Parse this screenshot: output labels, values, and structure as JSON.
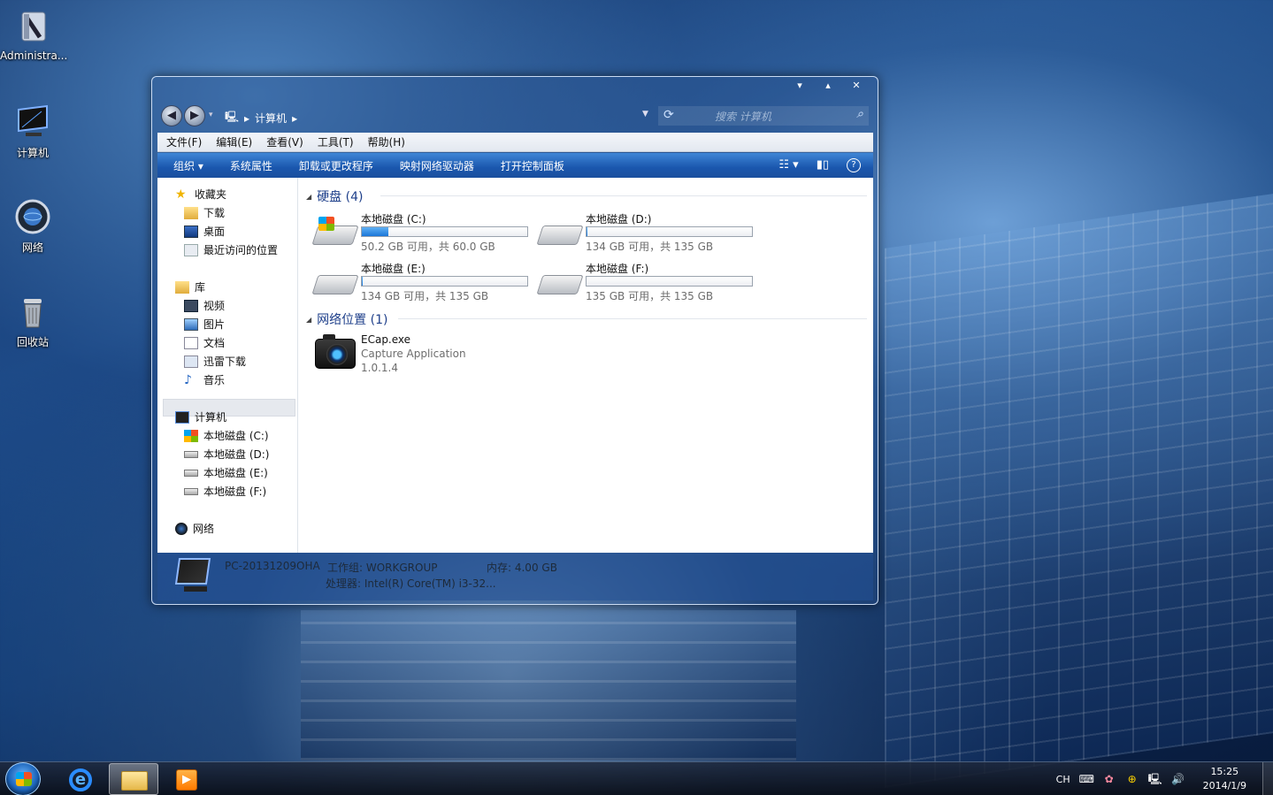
{
  "desktop": {
    "icons": [
      {
        "label": "Administra...",
        "icon": "user-folder-icon"
      },
      {
        "label": "计算机",
        "icon": "computer-icon"
      },
      {
        "label": "网络",
        "icon": "network-icon"
      },
      {
        "label": "回收站",
        "icon": "recycle-bin-icon"
      }
    ]
  },
  "window": {
    "breadcrumb": [
      "计算机"
    ],
    "search_placeholder": "搜索 计算机",
    "menu": [
      "文件(F)",
      "编辑(E)",
      "查看(V)",
      "工具(T)",
      "帮助(H)"
    ],
    "commands": [
      "组织 ▾",
      "系统属性",
      "卸载或更改程序",
      "映射网络驱动器",
      "打开控制面板"
    ],
    "nav": {
      "favorites": {
        "label": "收藏夹",
        "items": [
          "下载",
          "桌面",
          "最近访问的位置"
        ]
      },
      "libraries": {
        "label": "库",
        "items": [
          "视频",
          "图片",
          "文档",
          "迅雷下载",
          "音乐"
        ]
      },
      "computer": {
        "label": "计算机",
        "items": [
          "本地磁盘 (C:)",
          "本地磁盘 (D:)",
          "本地磁盘 (E:)",
          "本地磁盘 (F:)"
        ]
      },
      "network": {
        "label": "网络"
      }
    },
    "groups": {
      "hdd_header": "硬盘 (4)",
      "net_header": "网络位置 (1)"
    },
    "drives": [
      {
        "name": "本地磁盘 (C:)",
        "info": "50.2 GB 可用，共 60.0 GB",
        "used_fraction": 0.163,
        "system": true
      },
      {
        "name": "本地磁盘 (D:)",
        "info": "134 GB 可用，共 135 GB",
        "used_fraction": 0.007,
        "system": false
      },
      {
        "name": "本地磁盘 (E:)",
        "info": "134 GB 可用，共 135 GB",
        "used_fraction": 0.007,
        "system": false
      },
      {
        "name": "本地磁盘 (F:)",
        "info": "135 GB 可用，共 135 GB",
        "used_fraction": 0.0,
        "system": false
      }
    ],
    "network_item": {
      "name": "ECap.exe",
      "desc": "Capture Application",
      "version": "1.0.1.4"
    },
    "details": {
      "pc_name": "PC-20131209OHA",
      "workgroup": "工作组: WORKGROUP",
      "memory": "内存: 4.00 GB",
      "processor": "处理器: Intel(R) Core(TM) i3-32..."
    }
  },
  "taskbar": {
    "tray": {
      "lang": "CH",
      "time": "15:25",
      "date": "2014/1/9"
    }
  },
  "colors": {
    "accent": "#1a56ad",
    "drive_fill": "#1c77d8",
    "group_header": "#1e3f8a"
  }
}
